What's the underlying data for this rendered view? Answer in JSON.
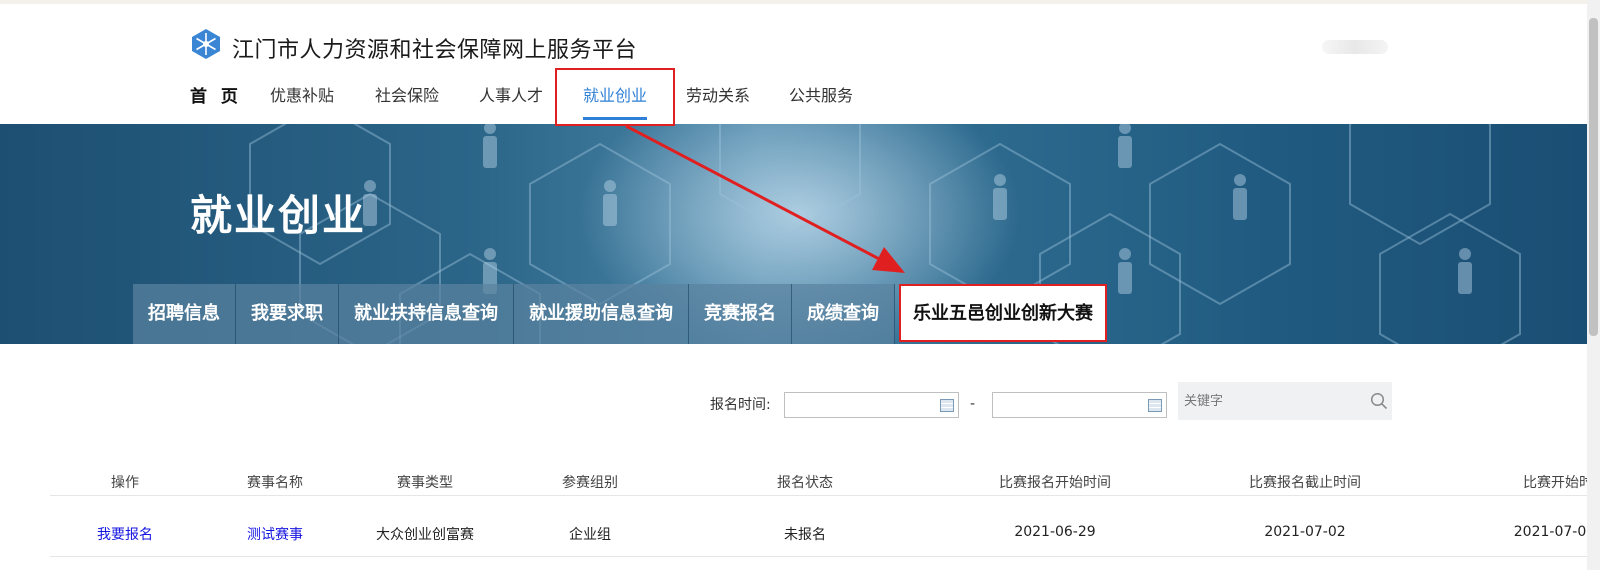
{
  "header": {
    "site_title": "江门市人力资源和社会保障网上服务平台"
  },
  "nav": {
    "items": [
      {
        "label": "首 页"
      },
      {
        "label": "优惠补贴"
      },
      {
        "label": "社会保险"
      },
      {
        "label": "人事人才"
      },
      {
        "label": "就业创业",
        "active": true
      },
      {
        "label": "劳动关系"
      },
      {
        "label": "公共服务"
      }
    ]
  },
  "banner": {
    "title": "就业创业"
  },
  "subtabs": [
    {
      "label": "招聘信息"
    },
    {
      "label": "我要求职"
    },
    {
      "label": "就业扶持信息查询"
    },
    {
      "label": "就业援助信息查询"
    },
    {
      "label": "竞赛报名"
    },
    {
      "label": "成绩查询"
    },
    {
      "label": "乐业五邑创业创新大赛",
      "active": true
    }
  ],
  "filters": {
    "date_label": "报名时间:",
    "separator": "-",
    "search_placeholder": "关键字"
  },
  "table": {
    "columns": [
      "操作",
      "赛事名称",
      "赛事类型",
      "参赛组别",
      "报名状态",
      "比赛报名开始时间",
      "比赛报名截止时间",
      "比赛开始时"
    ],
    "rows": [
      {
        "action": "我要报名",
        "name": "测试赛事",
        "type": "大众创业创富赛",
        "group": "企业组",
        "status": "未报名",
        "reg_start": "2021-06-29",
        "reg_end": "2021-07-02",
        "start": "2021-07-0"
      }
    ]
  },
  "colors": {
    "accent": "#2e7fd6",
    "annotation": "#e02020",
    "link": "#1515e0"
  }
}
